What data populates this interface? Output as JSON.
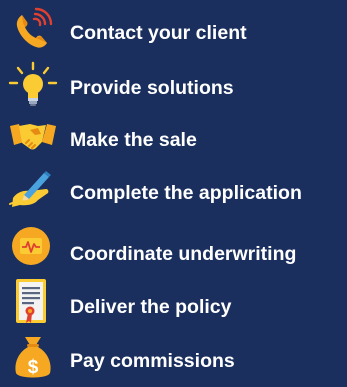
{
  "steps": [
    {
      "label": "Contact your client",
      "icon": "phone-icon"
    },
    {
      "label": "Provide solutions",
      "icon": "lightbulb-icon"
    },
    {
      "label": "Make the sale",
      "icon": "handshake-icon"
    },
    {
      "label": "Complete the application",
      "icon": "pen-writing-icon"
    },
    {
      "label": "Coordinate underwriting",
      "icon": "health-monitor-icon"
    },
    {
      "label": "Deliver the policy",
      "icon": "certificate-icon"
    },
    {
      "label": "Pay commissions",
      "icon": "money-bag-icon"
    }
  ],
  "colors": {
    "background": "#1a2f5d",
    "text": "#ffffff",
    "accent_orange": "#f7a823",
    "accent_yellow": "#fbcb34",
    "accent_red": "#e0402f"
  }
}
